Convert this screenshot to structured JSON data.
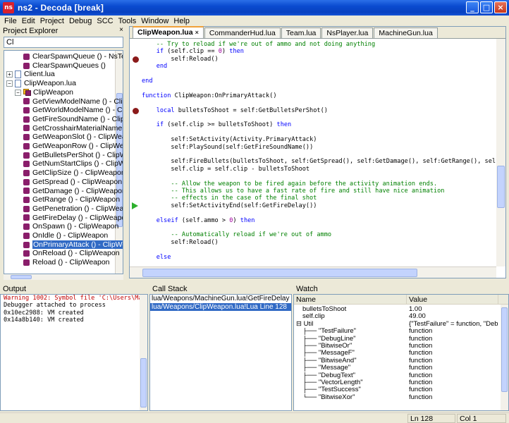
{
  "window": {
    "icon_text": "ns",
    "title": "ns2 - Decoda [break]",
    "minimize_glyph": "_",
    "maximize_glyph": "□",
    "close_glyph": "×"
  },
  "menu": [
    "File",
    "Edit",
    "Project",
    "Debug",
    "SCC",
    "Tools",
    "Window",
    "Help"
  ],
  "project_explorer": {
    "title": "Project Explorer",
    "close_glyph": "×",
    "search_value": "Cl",
    "items": [
      {
        "label": "ClearSpawnQueue () - NsTeam",
        "icon": "function-icon",
        "indent": 2,
        "expander": ""
      },
      {
        "label": "ClearSpawnQueues ()",
        "icon": "function-icon",
        "indent": 2,
        "expander": ""
      },
      {
        "label": "Client.lua",
        "icon": "file-icon",
        "indent": 0,
        "expander": "+"
      },
      {
        "label": "ClipWeapon.lua",
        "icon": "file-icon",
        "indent": 0,
        "expander": "−"
      },
      {
        "label": "ClipWeapon",
        "icon": "class-icon",
        "indent": 1,
        "expander": "−"
      },
      {
        "label": "GetViewModelName () - Clip'",
        "icon": "function-icon",
        "indent": 2,
        "expander": ""
      },
      {
        "label": "GetWorldModelName () - Clip",
        "icon": "function-icon",
        "indent": 2,
        "expander": ""
      },
      {
        "label": "GetFireSoundName () - Clip\\",
        "icon": "function-icon",
        "indent": 2,
        "expander": ""
      },
      {
        "label": "GetCrosshairMaterialName (",
        "icon": "function-icon",
        "indent": 2,
        "expander": ""
      },
      {
        "label": "GetWeaponSlot () - ClipWea",
        "icon": "function-icon",
        "indent": 2,
        "expander": ""
      },
      {
        "label": "GetWeaponRow () - ClipWe",
        "icon": "function-icon",
        "indent": 2,
        "expander": ""
      },
      {
        "label": "GetBulletsPerShot () - ClipW",
        "icon": "function-icon",
        "indent": 2,
        "expander": ""
      },
      {
        "label": "GetNumStartClips () - ClipW",
        "icon": "function-icon",
        "indent": 2,
        "expander": ""
      },
      {
        "label": "GetClipSize () - ClipWeapon",
        "icon": "function-icon",
        "indent": 2,
        "expander": ""
      },
      {
        "label": "GetSpread () - ClipWeapon",
        "icon": "function-icon",
        "indent": 2,
        "expander": ""
      },
      {
        "label": "GetDamage () - ClipWeapon",
        "icon": "function-icon",
        "indent": 2,
        "expander": ""
      },
      {
        "label": "GetRange () - ClipWeapon",
        "icon": "function-icon",
        "indent": 2,
        "expander": ""
      },
      {
        "label": "GetPenetration () - ClipWea",
        "icon": "function-icon",
        "indent": 2,
        "expander": ""
      },
      {
        "label": "GetFireDelay () - ClipWeapo",
        "icon": "function-icon",
        "indent": 2,
        "expander": ""
      },
      {
        "label": "OnSpawn () - ClipWeapon",
        "icon": "function-icon",
        "indent": 2,
        "expander": ""
      },
      {
        "label": "OnIdle () - ClipWeapon",
        "icon": "function-icon",
        "indent": 2,
        "expander": ""
      },
      {
        "label": "OnPrimaryAttack () - ClipWe",
        "icon": "function-icon",
        "indent": 2,
        "expander": "",
        "selected": true
      },
      {
        "label": "OnReload () - ClipWeapon",
        "icon": "function-icon",
        "indent": 2,
        "expander": ""
      },
      {
        "label": "Reload () - ClipWeapon",
        "icon": "function-icon",
        "indent": 2,
        "expander": ""
      }
    ]
  },
  "editor": {
    "tabs": [
      {
        "label": "ClipWeapon.lua",
        "active": true
      },
      {
        "label": "CommanderHud.lua",
        "active": false
      },
      {
        "label": "Team.lua",
        "active": false
      },
      {
        "label": "NsPlayer.lua",
        "active": false
      },
      {
        "label": "MachineGun.lua",
        "active": false
      }
    ],
    "tab_close_glyph": "×",
    "lines": [
      {
        "text": "    -- Try to reload if we're out of ammo and not doing anything",
        "marker": ""
      },
      {
        "text": "    if (self.clip == 0) then",
        "marker": ""
      },
      {
        "text": "        self:Reload()",
        "marker": "breakpoint"
      },
      {
        "text": "    end",
        "marker": ""
      },
      {
        "text": "",
        "marker": ""
      },
      {
        "text": "end",
        "marker": ""
      },
      {
        "text": "",
        "marker": ""
      },
      {
        "text": "function ClipWeapon:OnPrimaryAttack()",
        "marker": ""
      },
      {
        "text": "",
        "marker": ""
      },
      {
        "text": "    local bulletsToShoot = self:GetBulletsPerShot()",
        "marker": "breakpoint"
      },
      {
        "text": "",
        "marker": ""
      },
      {
        "text": "    if (self.clip >= bulletsToShoot) then",
        "marker": ""
      },
      {
        "text": "",
        "marker": ""
      },
      {
        "text": "        self:SetActivity(Activity.PrimaryAttack)",
        "marker": ""
      },
      {
        "text": "        self:PlaySound(self:GetFireSoundName())",
        "marker": ""
      },
      {
        "text": "",
        "marker": ""
      },
      {
        "text": "        self:FireBullets(bulletsToShoot, self:GetSpread(), self:GetDamage(), self:GetRange(), self:Get",
        "marker": ""
      },
      {
        "text": "        self.clip = self.clip - bulletsToShoot",
        "marker": ""
      },
      {
        "text": "",
        "marker": ""
      },
      {
        "text": "        -- Allow the weapon to be fired again before the activity animation ends.",
        "marker": ""
      },
      {
        "text": "        -- This allows us to have a fast rate of fire and still have nice animation",
        "marker": ""
      },
      {
        "text": "        -- effects in the case of the final shot",
        "marker": ""
      },
      {
        "text": "        self:SetActivityEnd(self:GetFireDelay())",
        "marker": "current"
      },
      {
        "text": "",
        "marker": ""
      },
      {
        "text": "    elseif (self.ammo > 0) then",
        "marker": ""
      },
      {
        "text": "",
        "marker": ""
      },
      {
        "text": "        -- Automatically reload if we're out of ammo",
        "marker": ""
      },
      {
        "text": "        self:Reload()",
        "marker": ""
      },
      {
        "text": "",
        "marker": ""
      },
      {
        "text": "    else",
        "marker": ""
      }
    ]
  },
  "output": {
    "title": "Output",
    "lines": [
      {
        "text": "Warning 1002: Symbol file 'C:\\Users\\Ma",
        "kind": "warn"
      },
      {
        "text": "Debugger attached to process",
        "kind": "normal"
      },
      {
        "text": "0x10ec2988: VM created",
        "kind": "normal"
      },
      {
        "text": "0x14a8b140: VM created",
        "kind": "normal"
      }
    ]
  },
  "call_stack": {
    "title": "Call Stack",
    "lines": [
      {
        "text": "lua/Weapons/MachineGun.lua!GetFireDelay Line 57",
        "selected": false
      },
      {
        "text": "lua/Weapons/ClipWeapon.lua!Lua Line 128",
        "selected": true
      }
    ]
  },
  "watch": {
    "title": "Watch",
    "columns": [
      "Name",
      "Value"
    ],
    "rows": [
      {
        "name": "bulletsToShoot",
        "value": "1.00",
        "indent": 1
      },
      {
        "name": "self.clip",
        "value": "49.00",
        "indent": 1
      },
      {
        "name": "⊟  Util",
        "value": "{\"TestFailure\" = function, \"DebugLine\"",
        "indent": 0
      },
      {
        "name": "├── \"TestFailure\"",
        "value": "function",
        "indent": 1
      },
      {
        "name": "├── \"DebugLine\"",
        "value": "function",
        "indent": 1
      },
      {
        "name": "├── \"BitwiseOr\"",
        "value": "function",
        "indent": 1
      },
      {
        "name": "├── \"MessageF\"",
        "value": "function",
        "indent": 1
      },
      {
        "name": "├── \"BitwiseAnd\"",
        "value": "function",
        "indent": 1
      },
      {
        "name": "├── \"Message\"",
        "value": "function",
        "indent": 1
      },
      {
        "name": "├── \"DebugText\"",
        "value": "function",
        "indent": 1
      },
      {
        "name": "├── \"VectorLength\"",
        "value": "function",
        "indent": 1
      },
      {
        "name": "├── \"TestSuccess\"",
        "value": "function",
        "indent": 1
      },
      {
        "name": "└── \"BitwiseXor\"",
        "value": "function",
        "indent": 1
      }
    ]
  },
  "status": {
    "line": "Ln 128",
    "col": "Col 1"
  }
}
